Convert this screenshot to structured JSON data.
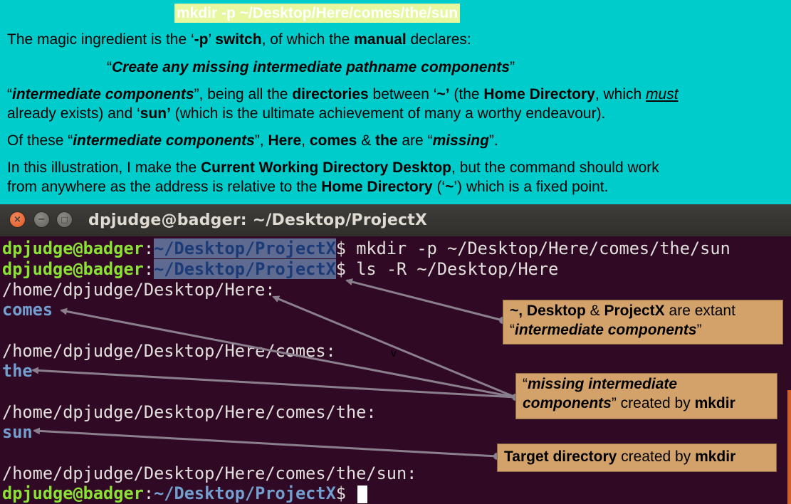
{
  "slide": {
    "command_title": "mkdir -p ~/Desktop/Here/comes/the/sun",
    "p1": {
      "t1": "The magic ingredient is the ‘",
      "t2": "-p",
      "t3": "’ ",
      "t4": "switch",
      "t5": ", of which the ",
      "t6": "manual",
      "t7": " declares:"
    },
    "quote": {
      "open": "“",
      "text": "Create any missing intermediate pathname components",
      "close": "”"
    },
    "p2": {
      "t1": "“",
      "t2": "intermediate components",
      "t3": "”, being all the ",
      "t4": "directories",
      "t5": " between ‘",
      "t6": "~’",
      "t7": " (the ",
      "t8": "Home Directory",
      "t9": ", which ",
      "t10": "must",
      "t11": "already exists) and ‘",
      "t12": "sun’",
      "t13": " (which is the ultimate achievement of many a worthy endeavour)."
    },
    "p3": {
      "t1": "Of these “",
      "t2": "intermediate components",
      "t3": "”, ",
      "t4": "Here",
      "t5": ", ",
      "t6": "comes",
      "t7": " & ",
      "t8": "the",
      "t9": " are “",
      "t10": "missing",
      "t11": "”."
    },
    "p4": {
      "t1": "In this illustration, I make the ",
      "t2": "Current Working Directory Desktop",
      "t3": ", but the command should work",
      "t4": "from anywhere as the address is  relative to the ",
      "t5": "Home Directory",
      "t6": " (‘",
      "t7": "~",
      "t8": "’) which is a fixed point."
    }
  },
  "terminal": {
    "window_title": "dpjudge@badger: ~/Desktop/ProjectX",
    "buttons": {
      "close": "×",
      "minimize": "−",
      "maximize": "□"
    },
    "user_host": "dpjudge@badger",
    "colon": ":",
    "cwd": "~/Desktop/ProjectX",
    "dollar": "$ ",
    "cmd1": "mkdir -p ~/Desktop/Here/comes/the/sun",
    "cmd2": "ls -R ~/Desktop/Here",
    "out": {
      "h1": "/home/dpjudge/Desktop/Here:",
      "d1": "comes",
      "h2": "/home/dpjudge/Desktop/Here/comes:",
      "d2": "the",
      "h3": "/home/dpjudge/Desktop/Here/comes/the:",
      "d3": "sun",
      "h4": "/home/dpjudge/Desktop/Here/comes/the/sun:"
    },
    "stray_mark": "v"
  },
  "callouts": {
    "c1": {
      "t1": "~, Desktop",
      "t2": " & ",
      "t3": "ProjectX",
      "t4": " are extant",
      "t5": "“",
      "t6": "intermediate components",
      "t7": "”"
    },
    "c2": {
      "t1": "“",
      "t2": "missing intermediate",
      "t3": "components",
      "t4": "” created by ",
      "t5": "mkdir"
    },
    "c3": {
      "t1": "Target directory",
      "t2": " created by ",
      "t3": "mkdir"
    }
  },
  "colors": {
    "slide_background": "#00cccc",
    "terminal_background": "#300a24",
    "prompt_user": "#8ae234",
    "prompt_path": "#729fcf",
    "callout_fill": "#d2a26a",
    "arrow": "#8a7f8d",
    "close_button": "#e05a23"
  }
}
